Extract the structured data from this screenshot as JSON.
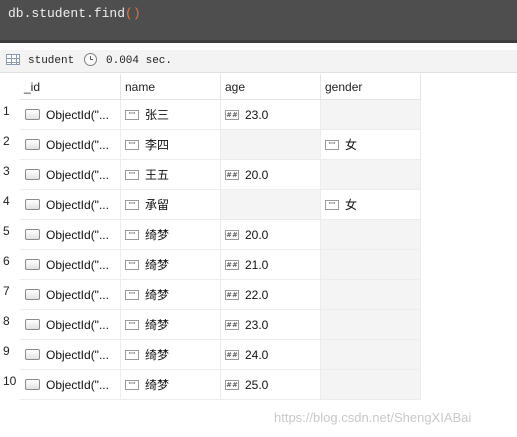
{
  "editor": {
    "command": "db.student.find",
    "parens": "()"
  },
  "status": {
    "collection": "student",
    "elapsed": "0.004 sec."
  },
  "columns": [
    "_id",
    "name",
    "age",
    "gender"
  ],
  "rows": [
    {
      "num": "1",
      "id": "ObjectId(\"...",
      "name": "张三",
      "age": "23.0",
      "gender": ""
    },
    {
      "num": "2",
      "id": "ObjectId(\"...",
      "name": "李四",
      "age": "",
      "gender": "女"
    },
    {
      "num": "3",
      "id": "ObjectId(\"...",
      "name": "王五",
      "age": "20.0",
      "gender": ""
    },
    {
      "num": "4",
      "id": "ObjectId(\"...",
      "name": "承留",
      "age": "",
      "gender": "女"
    },
    {
      "num": "5",
      "id": "ObjectId(\"...",
      "name": "绮梦",
      "age": "20.0",
      "gender": ""
    },
    {
      "num": "6",
      "id": "ObjectId(\"...",
      "name": "绮梦",
      "age": "21.0",
      "gender": ""
    },
    {
      "num": "7",
      "id": "ObjectId(\"...",
      "name": "绮梦",
      "age": "22.0",
      "gender": ""
    },
    {
      "num": "8",
      "id": "ObjectId(\"...",
      "name": "绮梦",
      "age": "23.0",
      "gender": ""
    },
    {
      "num": "9",
      "id": "ObjectId(\"...",
      "name": "绮梦",
      "age": "24.0",
      "gender": ""
    },
    {
      "num": "10",
      "id": "ObjectId(\"...",
      "name": "绮梦",
      "age": "25.0",
      "gender": ""
    }
  ],
  "icons": {
    "string_type": "\"\"",
    "number_type": "##"
  },
  "watermark": "https://blog.csdn.net/ShengXIABai"
}
